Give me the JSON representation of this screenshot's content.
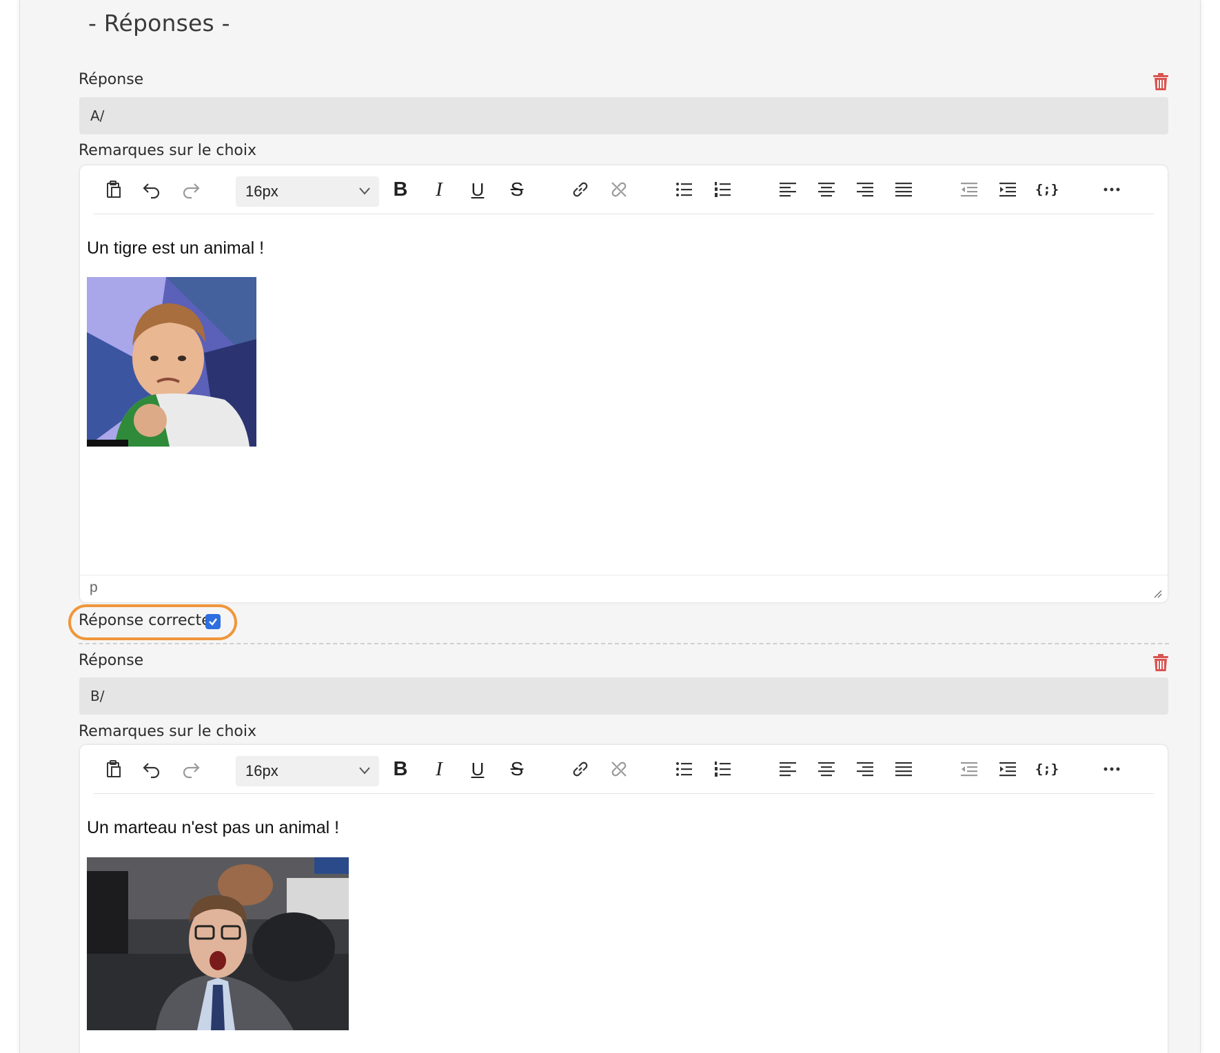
{
  "section_title": "- Réponses -",
  "answers": [
    {
      "label": "Réponse",
      "value": "A/",
      "remarks_label": "Remarques sur le choix",
      "font_size": "16px",
      "content_text": "Un tigre est un animal !",
      "image_alt": "success-kid-meme",
      "status_path": "p",
      "correct_label": "Réponse correcte",
      "correct_checked": true
    },
    {
      "label": "Réponse",
      "value": "B/",
      "remarks_label": "Remarques sur le choix",
      "font_size": "16px",
      "content_text": "Un marteau n'est pas un animal !",
      "image_alt": "shocked-coach-gif"
    }
  ],
  "toolbar_icons": [
    "paste-icon",
    "undo-icon",
    "redo-icon",
    "font-size-select",
    "bold-icon",
    "italic-icon",
    "underline-icon",
    "strikethrough-icon",
    "link-icon",
    "unlink-icon",
    "bullet-list-icon",
    "numbered-list-icon",
    "align-left-icon",
    "align-center-icon",
    "align-right-icon",
    "align-justify-icon",
    "outdent-icon",
    "indent-icon",
    "code-icon",
    "more-icon"
  ],
  "colors": {
    "trash": "#d9534f",
    "highlight": "#f0963a",
    "checkbox": "#2d6fe0",
    "input_bg": "#e5e5e5",
    "panel_bg": "#f5f5f5"
  }
}
